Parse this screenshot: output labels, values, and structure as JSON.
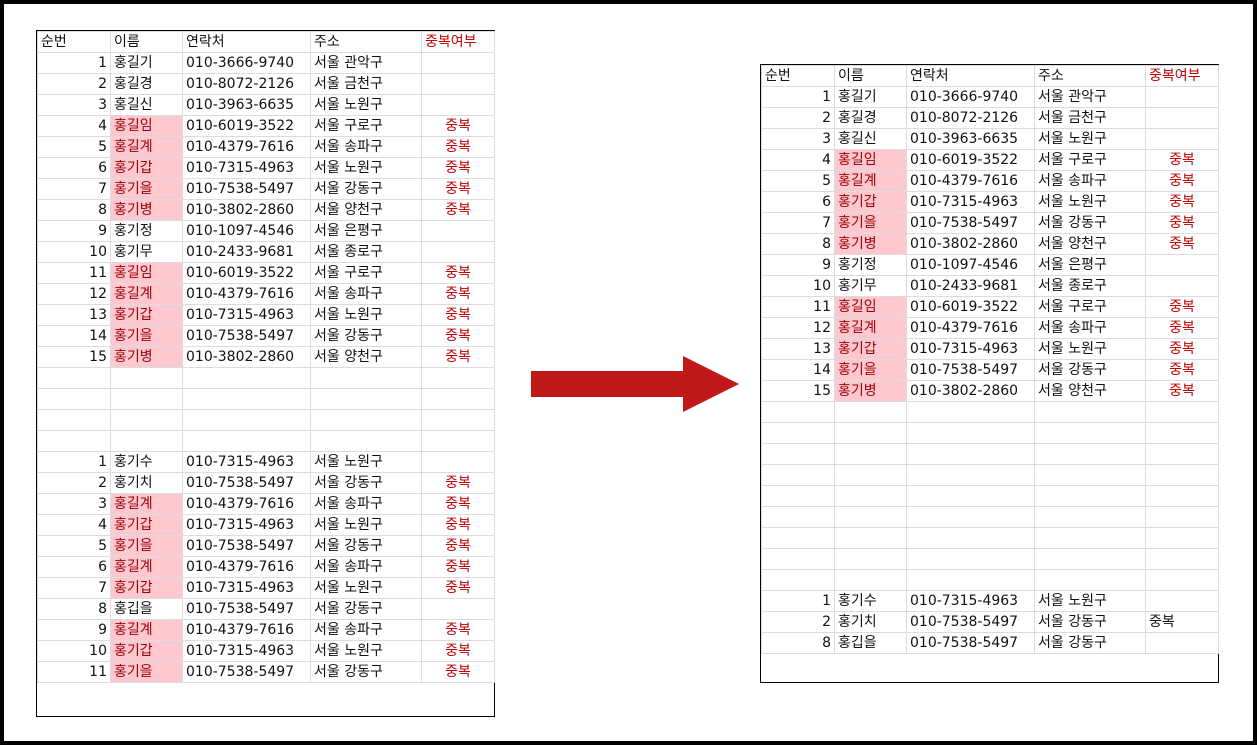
{
  "columns": [
    "순번",
    "이름",
    "연락처",
    "주소",
    "중복여부"
  ],
  "colors": {
    "highlight_fill": "#ffc7ce",
    "highlight_text": "#9c0006",
    "dup_text": "#c00000",
    "arrow": "#c0191a"
  },
  "arrow_icon": "arrow-right-icon",
  "left": {
    "rows": [
      {
        "no": "1",
        "name": "홍길기",
        "phone": "010-3666-9740",
        "addr": "서울 관악구",
        "dup": "",
        "hl": false
      },
      {
        "no": "2",
        "name": "홍길경",
        "phone": "010-8072-2126",
        "addr": "서울 금천구",
        "dup": "",
        "hl": false
      },
      {
        "no": "3",
        "name": "홍길신",
        "phone": "010-3963-6635",
        "addr": "서울 노원구",
        "dup": "",
        "hl": false
      },
      {
        "no": "4",
        "name": "홍길임",
        "phone": "010-6019-3522",
        "addr": "서울 구로구",
        "dup": "중복",
        "hl": true
      },
      {
        "no": "5",
        "name": "홍길계",
        "phone": "010-4379-7616",
        "addr": "서울 송파구",
        "dup": "중복",
        "hl": true
      },
      {
        "no": "6",
        "name": "홍기갑",
        "phone": "010-7315-4963",
        "addr": "서울 노원구",
        "dup": "중복",
        "hl": true
      },
      {
        "no": "7",
        "name": "홍기을",
        "phone": "010-7538-5497",
        "addr": "서울 강동구",
        "dup": "중복",
        "hl": true
      },
      {
        "no": "8",
        "name": "홍기병",
        "phone": "010-3802-2860",
        "addr": "서울 양천구",
        "dup": "중복",
        "hl": true
      },
      {
        "no": "9",
        "name": "홍기정",
        "phone": "010-1097-4546",
        "addr": "서울 은평구",
        "dup": "",
        "hl": false
      },
      {
        "no": "10",
        "name": "홍기무",
        "phone": "010-2433-9681",
        "addr": "서울 종로구",
        "dup": "",
        "hl": false
      },
      {
        "no": "11",
        "name": "홍길임",
        "phone": "010-6019-3522",
        "addr": "서울 구로구",
        "dup": "중복",
        "hl": true
      },
      {
        "no": "12",
        "name": "홍길계",
        "phone": "010-4379-7616",
        "addr": "서울 송파구",
        "dup": "중복",
        "hl": true
      },
      {
        "no": "13",
        "name": "홍기갑",
        "phone": "010-7315-4963",
        "addr": "서울 노원구",
        "dup": "중복",
        "hl": true
      },
      {
        "no": "14",
        "name": "홍기을",
        "phone": "010-7538-5497",
        "addr": "서울 강동구",
        "dup": "중복",
        "hl": true
      },
      {
        "no": "15",
        "name": "홍기병",
        "phone": "010-3802-2860",
        "addr": "서울 양천구",
        "dup": "중복",
        "hl": true
      },
      {
        "no": "",
        "name": "",
        "phone": "",
        "addr": "",
        "dup": "",
        "hl": false
      },
      {
        "no": "",
        "name": "",
        "phone": "",
        "addr": "",
        "dup": "",
        "hl": false
      },
      {
        "no": "",
        "name": "",
        "phone": "",
        "addr": "",
        "dup": "",
        "hl": false
      },
      {
        "no": "",
        "name": "",
        "phone": "",
        "addr": "",
        "dup": "",
        "hl": false
      },
      {
        "no": "1",
        "name": "홍기수",
        "phone": "010-7315-4963",
        "addr": "서울 노원구",
        "dup": "",
        "hl": false
      },
      {
        "no": "2",
        "name": "홍기치",
        "phone": "010-7538-5497",
        "addr": "서울 강동구",
        "dup": "중복",
        "hl": false
      },
      {
        "no": "3",
        "name": "홍길계",
        "phone": "010-4379-7616",
        "addr": "서울 송파구",
        "dup": "중복",
        "hl": true
      },
      {
        "no": "4",
        "name": "홍기갑",
        "phone": "010-7315-4963",
        "addr": "서울 노원구",
        "dup": "중복",
        "hl": true
      },
      {
        "no": "5",
        "name": "홍기을",
        "phone": "010-7538-5497",
        "addr": "서울 강동구",
        "dup": "중복",
        "hl": true
      },
      {
        "no": "6",
        "name": "홍길계",
        "phone": "010-4379-7616",
        "addr": "서울 송파구",
        "dup": "중복",
        "hl": true
      },
      {
        "no": "7",
        "name": "홍기갑",
        "phone": "010-7315-4963",
        "addr": "서울 노원구",
        "dup": "중복",
        "hl": true
      },
      {
        "no": "8",
        "name": "홍깁을",
        "phone": "010-7538-5497",
        "addr": "서울 강동구",
        "dup": "",
        "hl": false
      },
      {
        "no": "9",
        "name": "홍길계",
        "phone": "010-4379-7616",
        "addr": "서울 송파구",
        "dup": "중복",
        "hl": true
      },
      {
        "no": "10",
        "name": "홍기갑",
        "phone": "010-7315-4963",
        "addr": "서울 노원구",
        "dup": "중복",
        "hl": true
      },
      {
        "no": "11",
        "name": "홍기을",
        "phone": "010-7538-5497",
        "addr": "서울 강동구",
        "dup": "중복",
        "hl": true
      }
    ]
  },
  "right": {
    "rows": [
      {
        "no": "1",
        "name": "홍길기",
        "phone": "010-3666-9740",
        "addr": "서울 관악구",
        "dup": "",
        "hl": false
      },
      {
        "no": "2",
        "name": "홍길경",
        "phone": "010-8072-2126",
        "addr": "서울 금천구",
        "dup": "",
        "hl": false
      },
      {
        "no": "3",
        "name": "홍길신",
        "phone": "010-3963-6635",
        "addr": "서울 노원구",
        "dup": "",
        "hl": false
      },
      {
        "no": "4",
        "name": "홍길임",
        "phone": "010-6019-3522",
        "addr": "서울 구로구",
        "dup": "중복",
        "hl": true
      },
      {
        "no": "5",
        "name": "홍길계",
        "phone": "010-4379-7616",
        "addr": "서울 송파구",
        "dup": "중복",
        "hl": true
      },
      {
        "no": "6",
        "name": "홍기갑",
        "phone": "010-7315-4963",
        "addr": "서울 노원구",
        "dup": "중복",
        "hl": true
      },
      {
        "no": "7",
        "name": "홍기을",
        "phone": "010-7538-5497",
        "addr": "서울 강동구",
        "dup": "중복",
        "hl": true
      },
      {
        "no": "8",
        "name": "홍기병",
        "phone": "010-3802-2860",
        "addr": "서울 양천구",
        "dup": "중복",
        "hl": true
      },
      {
        "no": "9",
        "name": "홍기정",
        "phone": "010-1097-4546",
        "addr": "서울 은평구",
        "dup": "",
        "hl": false
      },
      {
        "no": "10",
        "name": "홍기무",
        "phone": "010-2433-9681",
        "addr": "서울 종로구",
        "dup": "",
        "hl": false
      },
      {
        "no": "11",
        "name": "홍길임",
        "phone": "010-6019-3522",
        "addr": "서울 구로구",
        "dup": "중복",
        "hl": true
      },
      {
        "no": "12",
        "name": "홍길계",
        "phone": "010-4379-7616",
        "addr": "서울 송파구",
        "dup": "중복",
        "hl": true
      },
      {
        "no": "13",
        "name": "홍기갑",
        "phone": "010-7315-4963",
        "addr": "서울 노원구",
        "dup": "중복",
        "hl": true
      },
      {
        "no": "14",
        "name": "홍기을",
        "phone": "010-7538-5497",
        "addr": "서울 강동구",
        "dup": "중복",
        "hl": true
      },
      {
        "no": "15",
        "name": "홍기병",
        "phone": "010-3802-2860",
        "addr": "서울 양천구",
        "dup": "중복",
        "hl": true
      },
      {
        "no": "",
        "name": "",
        "phone": "",
        "addr": "",
        "dup": "",
        "hl": false
      },
      {
        "no": "",
        "name": "",
        "phone": "",
        "addr": "",
        "dup": "",
        "hl": false
      },
      {
        "no": "",
        "name": "",
        "phone": "",
        "addr": "",
        "dup": "",
        "hl": false
      },
      {
        "no": "",
        "name": "",
        "phone": "",
        "addr": "",
        "dup": "",
        "hl": false
      },
      {
        "no": "",
        "name": "",
        "phone": "",
        "addr": "",
        "dup": "",
        "hl": false
      },
      {
        "no": "",
        "name": "",
        "phone": "",
        "addr": "",
        "dup": "",
        "hl": false
      },
      {
        "no": "",
        "name": "",
        "phone": "",
        "addr": "",
        "dup": "",
        "hl": false
      },
      {
        "no": "",
        "name": "",
        "phone": "",
        "addr": "",
        "dup": "",
        "hl": false
      },
      {
        "no": "",
        "name": "",
        "phone": "",
        "addr": "",
        "dup": "",
        "hl": false
      },
      {
        "no": "1",
        "name": "홍기수",
        "phone": "010-7315-4963",
        "addr": "서울 노원구",
        "dup": "",
        "hl": false
      },
      {
        "no": "2",
        "name": "홍기치",
        "phone": "010-7538-5497",
        "addr": "서울 강동구",
        "dup": "중복",
        "hl": false,
        "plain": true
      },
      {
        "no": "8",
        "name": "홍깁을",
        "phone": "010-7538-5497",
        "addr": "서울 강동구",
        "dup": "",
        "hl": false
      }
    ]
  }
}
